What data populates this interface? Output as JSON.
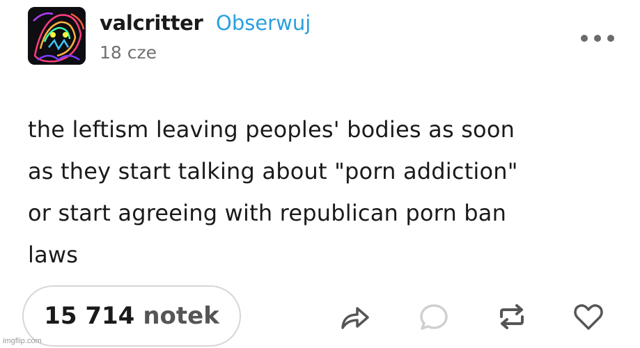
{
  "post": {
    "username": "valcritter",
    "follow_label": "Obserwuj",
    "date": "18 cze",
    "body": "the leftism leaving peoples' bodies as soon\nas they start talking about \"porn addiction\"\nor start agreeing with republican porn ban\nlaws"
  },
  "footer": {
    "notes_count": "15 714",
    "notes_label": "notek"
  },
  "watermark": "imgflip.com",
  "colors": {
    "follow": "#2aa0dd",
    "text": "#1a1a1a",
    "muted": "#707070",
    "icon": "#555555",
    "reply_icon": "#cfcfcf"
  },
  "icons": {
    "avatar": "neon-creature-avatar",
    "more": "more-options-icon",
    "share": "share-icon",
    "reply": "reply-icon",
    "reblog": "reblog-icon",
    "like": "heart-icon"
  }
}
